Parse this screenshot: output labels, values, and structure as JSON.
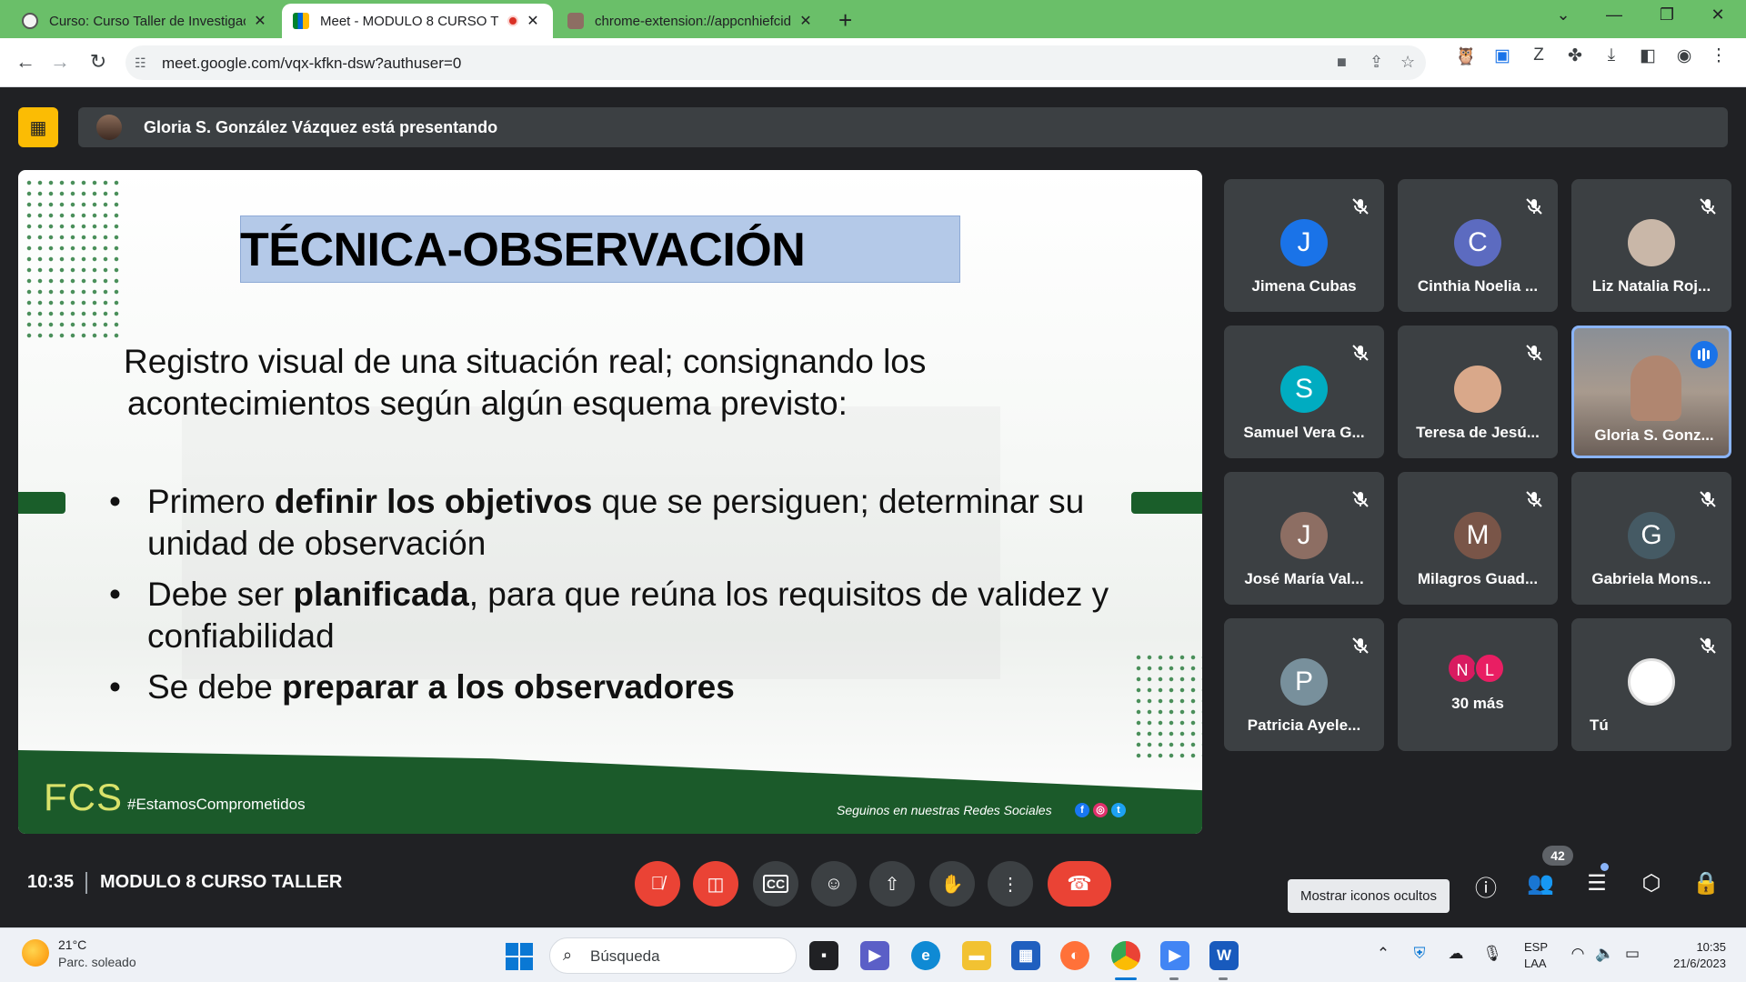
{
  "browser": {
    "tabs": [
      {
        "title": "Curso: Curso Taller de Investigaci",
        "active": false
      },
      {
        "title": "Meet - MODULO 8 CURSO T",
        "active": true,
        "recording": true
      },
      {
        "title": "chrome-extension://appcnhiefcid",
        "active": false
      }
    ],
    "url": "meet.google.com/vqx-kfkn-dsw?authuser=0"
  },
  "meet": {
    "presenting_banner": "Gloria S. González Vázquez está presentando",
    "slide": {
      "title": "TÉCNICA-OBSERVACIÓN",
      "intro_line1": "Registro visual  de una situación real;  consignando los",
      "intro_line2": "acontecimientos según algún  esquema previsto:",
      "bullets": [
        {
          "pre": "Primero  ",
          "bold": "definir los objetivos",
          "post": " que se persiguen;  determinar su unidad de observación"
        },
        {
          "pre": "Debe ser ",
          "bold": "planificada",
          "post": ",  para que reúna  los  requisitos de validez y confiabilidad"
        },
        {
          "pre": "Se debe ",
          "bold": "preparar  a los observadores",
          "post": ""
        }
      ],
      "logo": "FCS",
      "hashtag": "#EstamosComprometidos",
      "social_text": "Seguinos en nuestras Redes Sociales"
    },
    "participants": [
      {
        "name": "Jimena Cubas",
        "initial": "J",
        "color": "#1a73e8"
      },
      {
        "name": "Cinthia Noelia ...",
        "initial": "C",
        "color": "#5c6bc0"
      },
      {
        "name": "Liz Natalia Roj...",
        "initial": "",
        "color": "#c9b7a8"
      },
      {
        "name": "Samuel Vera G...",
        "initial": "S",
        "color": "#00acc1"
      },
      {
        "name": "Teresa de Jesú...",
        "initial": "",
        "color": "#d9a88a"
      },
      {
        "name": "Gloria S. Gonz...",
        "initial": "",
        "color": ""
      },
      {
        "name": "José María Val...",
        "initial": "J",
        "color": "#8d6e63"
      },
      {
        "name": "Milagros Guad...",
        "initial": "M",
        "color": "#795548"
      },
      {
        "name": "Gabriela Mons...",
        "initial": "G",
        "color": "#455a64"
      },
      {
        "name": "Patricia Ayele...",
        "initial": "P",
        "color": "#78909c"
      },
      {
        "name": "30 más",
        "initial": "",
        "color": ""
      },
      {
        "name": "Tú",
        "initial": "",
        "color": "#ffffff"
      }
    ],
    "more_avatars": [
      "N",
      "L"
    ],
    "clock": "10:35",
    "meeting_name": "MODULO 8 CURSO TALLER",
    "people_count": "42",
    "tooltip": "Mostrar iconos ocultos"
  },
  "taskbar": {
    "temperature": "21°C",
    "weather": "Parc. soleado",
    "search_placeholder": "Búsqueda",
    "lang1": "ESP",
    "lang2": "LAA",
    "time": "10:35",
    "date": "21/6/2023"
  }
}
